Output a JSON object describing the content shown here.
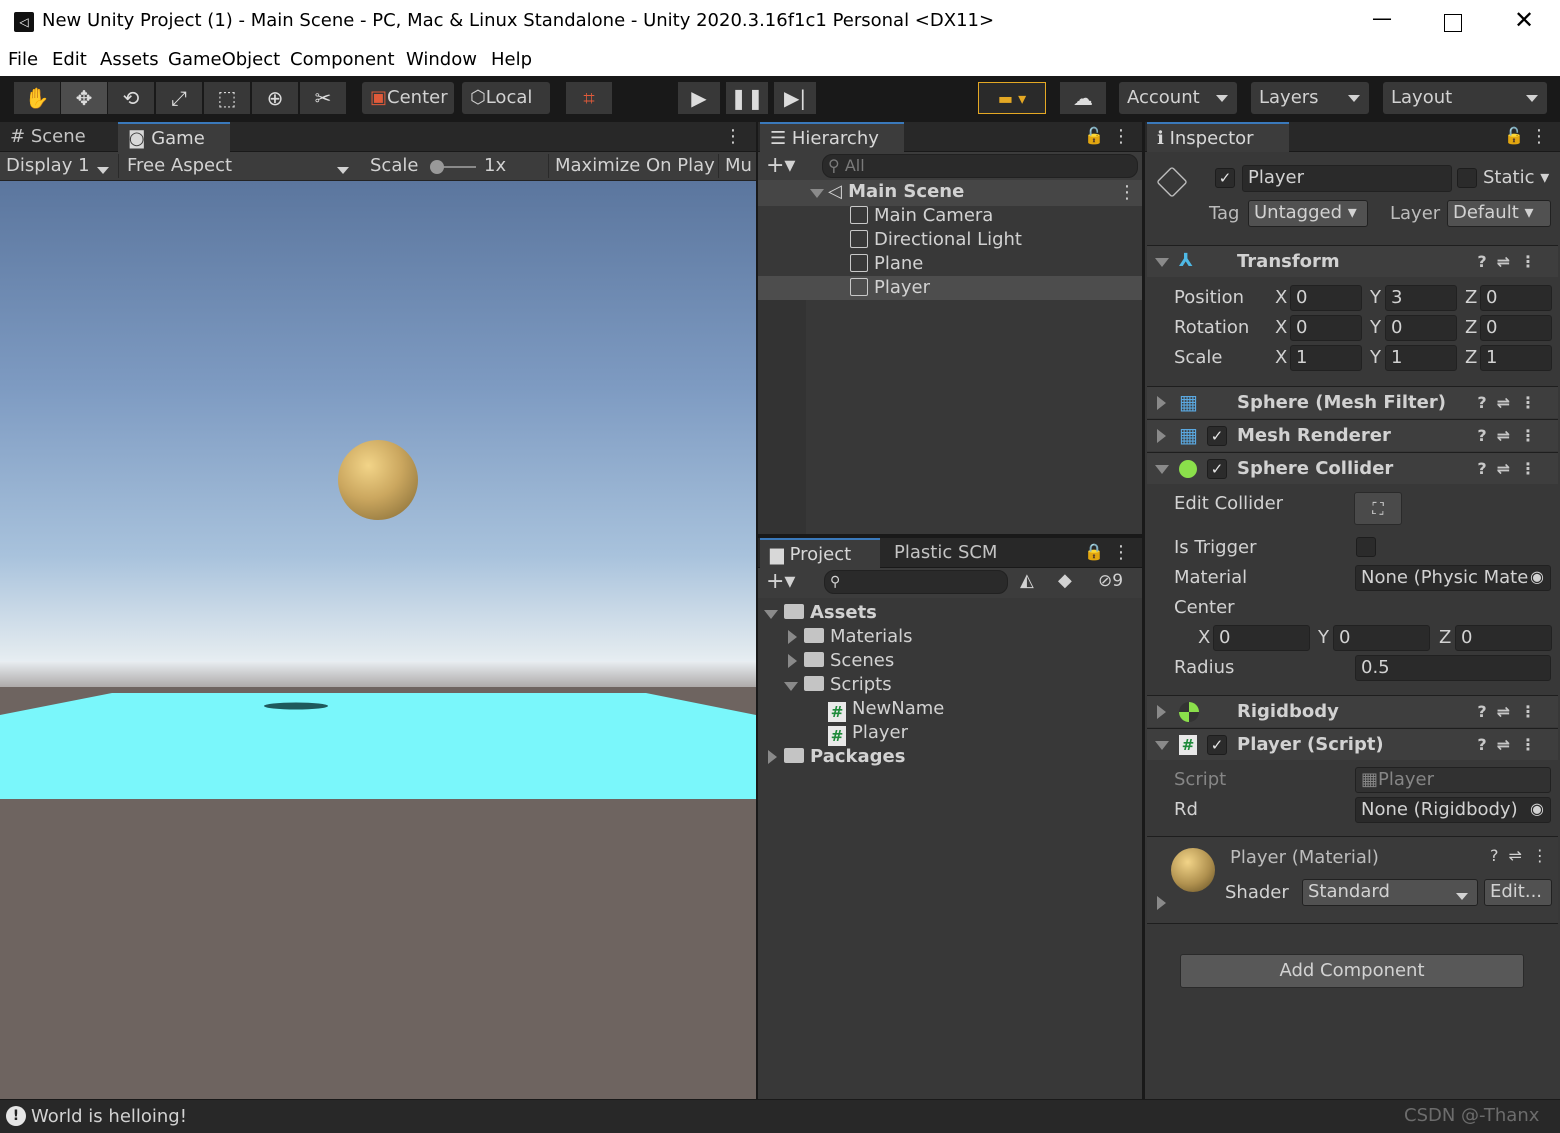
{
  "window": {
    "title": "New Unity Project (1) - Main Scene - PC, Mac & Linux Standalone - Unity 2020.3.16f1c1 Personal <DX11>"
  },
  "menu": [
    "File",
    "Edit",
    "Assets",
    "GameObject",
    "Component",
    "Window",
    "Help"
  ],
  "toolbar": {
    "pivot": "Center",
    "space": "Local",
    "account": "Account",
    "layers": "Layers",
    "layout": "Layout"
  },
  "game_view": {
    "tabs": [
      "Scene",
      "Game"
    ],
    "display": "Display 1",
    "aspect": "Free Aspect",
    "scale_label": "Scale",
    "scale_value": "1x",
    "maximize": "Maximize On Play",
    "mute": "Mu"
  },
  "hierarchy": {
    "tab": "Hierarchy",
    "search_placeholder": "All",
    "scene": "Main Scene",
    "items": [
      "Main Camera",
      "Directional Light",
      "Plane",
      "Player"
    ]
  },
  "project": {
    "tabs": [
      "Project",
      "Plastic SCM"
    ],
    "hidden_count": "9",
    "tree": [
      {
        "label": "Assets",
        "level": 0
      },
      {
        "label": "Materials",
        "level": 1
      },
      {
        "label": "Scenes",
        "level": 1
      },
      {
        "label": "Scripts",
        "level": 1
      },
      {
        "label": "NewName",
        "level": 2
      },
      {
        "label": "Player",
        "level": 2
      },
      {
        "label": "Packages",
        "level": 0
      }
    ]
  },
  "inspector": {
    "tab": "Inspector",
    "object_name": "Player",
    "static_label": "Static",
    "tag_label": "Tag",
    "tag_value": "Untagged",
    "layer_label": "Layer",
    "layer_value": "Default",
    "transform": {
      "title": "Transform",
      "position": {
        "label": "Position",
        "x": "0",
        "y": "3",
        "z": "0"
      },
      "rotation": {
        "label": "Rotation",
        "x": "0",
        "y": "0",
        "z": "0"
      },
      "scale": {
        "label": "Scale",
        "x": "1",
        "y": "1",
        "z": "1"
      }
    },
    "mesh_filter": "Sphere (Mesh Filter)",
    "mesh_renderer": "Mesh Renderer",
    "sphere_collider": {
      "title": "Sphere Collider",
      "edit_collider": "Edit Collider",
      "is_trigger": "Is Trigger",
      "material_label": "Material",
      "material_value": "None (Physic Mate",
      "center_label": "Center",
      "cx": "0",
      "cy": "0",
      "cz": "0",
      "radius_label": "Radius",
      "radius_value": "0.5"
    },
    "rigidbody": "Rigidbody",
    "player_script": {
      "title": "Player (Script)",
      "script_label": "Script",
      "script_value": "Player",
      "rd_label": "Rd",
      "rd_value": "None (Rigidbody)"
    },
    "material": {
      "title": "Player (Material)",
      "shader_label": "Shader",
      "shader_value": "Standard",
      "edit": "Edit..."
    },
    "add_component": "Add Component"
  },
  "status": {
    "message": "World is helloing!",
    "watermark": "CSDN @-Thanx"
  },
  "axis_letters": {
    "x": "X",
    "y": "Y",
    "z": "Z"
  }
}
